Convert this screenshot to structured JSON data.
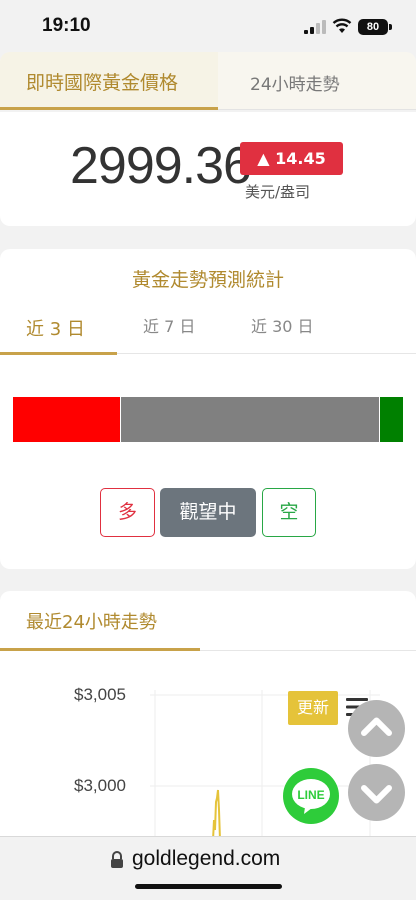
{
  "status_bar": {
    "time": "19:10",
    "battery": "80"
  },
  "price_tabs": {
    "active": "即時國際黃金價格",
    "inactive": "24小時走勢"
  },
  "price": {
    "value": "2999.36",
    "change": "▲ 14.45",
    "unit": "美元/盎司"
  },
  "forecast": {
    "title": "黃金走勢預測統計",
    "periods": [
      "近 3 日",
      "近 7 日",
      "近 30 日"
    ],
    "active_period": 0,
    "distribution": {
      "long": 0.275,
      "watch": 0.667,
      "short": 0.058
    },
    "colors": {
      "long": "#ff0000",
      "watch": "#808080",
      "short": "#008000"
    },
    "buttons": {
      "long": "多",
      "watch": "觀望中",
      "short": "空"
    }
  },
  "chart": {
    "title": "最近24小時走勢",
    "y_ticks": [
      "$3,005",
      "$3,000"
    ],
    "update_label": "更新"
  },
  "chart_data": {
    "type": "line",
    "y_ticks": [
      3005,
      3000
    ],
    "line_color": "#e5c33a",
    "grid": true
  },
  "floating": {
    "line_label": "LINE"
  },
  "browser": {
    "url": "goldlegend.com"
  }
}
